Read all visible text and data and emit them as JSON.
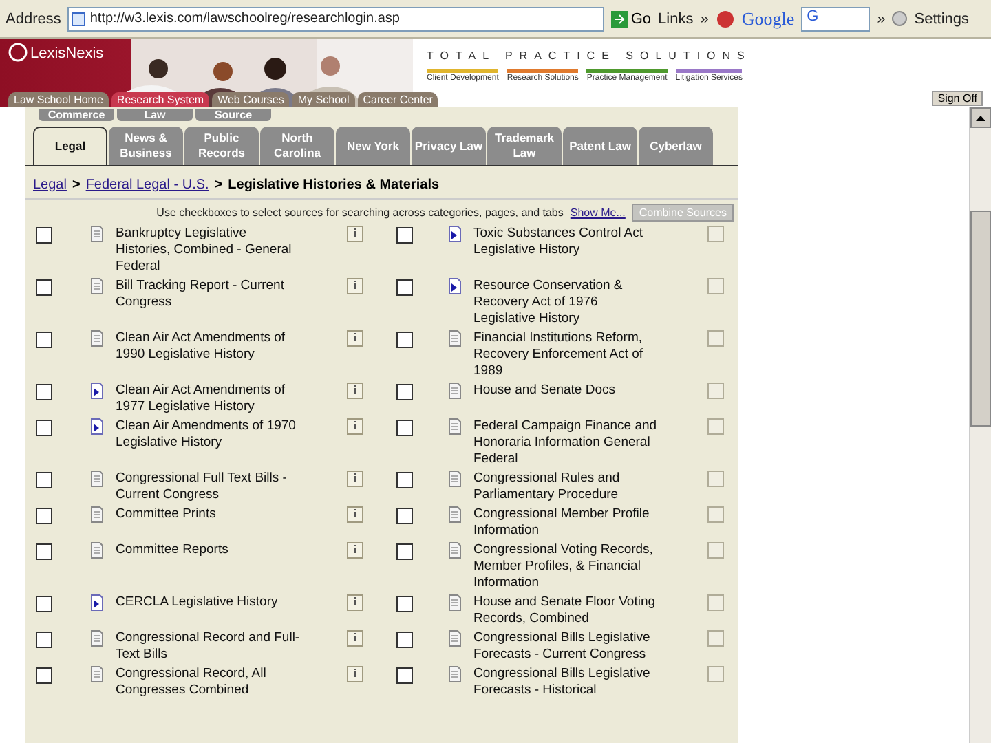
{
  "toolbar": {
    "address_label": "Address",
    "url": "http://w3.lexis.com/lawschoolreg/researchlogin.asp",
    "go": "Go",
    "links": "Links",
    "chevron": "»",
    "search_brand": "Google",
    "search_letter": "G",
    "chevron_2": "»",
    "settings": "Settings"
  },
  "banner": {
    "logo": "LexisNexis",
    "tagline": "TOTAL PRACTICE SOLUTIONS",
    "solutions": [
      {
        "label": "Client Development",
        "color": "#e0b52e"
      },
      {
        "label": "Research Solutions",
        "color": "#e07a2e"
      },
      {
        "label": "Practice Management",
        "color": "#4f9a2e"
      },
      {
        "label": "Litigation Services",
        "color": "#9a78c8"
      }
    ]
  },
  "nav": [
    {
      "label": "Law School Home",
      "selected": false
    },
    {
      "label": "Research System",
      "selected": true
    },
    {
      "label": "Web Courses",
      "selected": false
    },
    {
      "label": "My School",
      "selected": false
    },
    {
      "label": "Career Center",
      "selected": false
    }
  ],
  "sign_off": "Sign Off",
  "back_tabs": [
    "Commerce",
    "Law",
    "Source"
  ],
  "tabs": [
    {
      "label": "Legal",
      "selected": true
    },
    {
      "label": "News & Business",
      "selected": false
    },
    {
      "label": "Public Records",
      "selected": false
    },
    {
      "label": "North Carolina",
      "selected": false
    },
    {
      "label": "New York",
      "selected": false
    },
    {
      "label": "Privacy Law",
      "selected": false
    },
    {
      "label": "Trademark Law",
      "selected": false
    },
    {
      "label": "Patent Law",
      "selected": false
    },
    {
      "label": "Cyberlaw",
      "selected": false
    }
  ],
  "breadcrumb": {
    "links": [
      "Legal",
      "Federal Legal - U.S."
    ],
    "separator": ">",
    "current": "Legislative Histories & Materials"
  },
  "instructions": "Use checkboxes to select sources for searching across categories, pages, and tabs",
  "show_me": "Show Me...",
  "combine": {
    "label": "Combine Sources",
    "disabled": true
  },
  "rows": [
    {
      "left": {
        "title": "Bankruptcy Legislative Histories, Combined - General Federal",
        "kind": "document",
        "checked": false
      },
      "right": {
        "title": "Toxic Substances Control Act Legislative History",
        "kind": "linked",
        "checked": false
      }
    },
    {
      "left": {
        "title": "Bill Tracking Report - Current Congress",
        "kind": "document",
        "checked": false
      },
      "right": {
        "title": "Resource Conservation & Recovery Act of 1976 Legislative History",
        "kind": "linked",
        "checked": false
      }
    },
    {
      "left": {
        "title": "Clean Air Act Amendments of 1990 Legislative History",
        "kind": "document",
        "checked": false
      },
      "right": {
        "title": "Financial Institutions Reform, Recovery Enforcement Act of 1989",
        "kind": "document",
        "checked": false
      }
    },
    {
      "left": {
        "title": "Clean Air Act Amendments of 1977 Legislative History",
        "kind": "linked",
        "checked": false
      },
      "right": {
        "title": "House and Senate Docs",
        "kind": "document",
        "checked": false
      }
    },
    {
      "left": {
        "title": "Clean Air Amendments of 1970 Legislative History",
        "kind": "linked",
        "checked": false
      },
      "right": {
        "title": "Federal Campaign Finance and Honoraria Information General Federal",
        "kind": "document",
        "checked": false
      }
    },
    {
      "left": {
        "title": "Congressional Full Text Bills - Current Congress",
        "kind": "document",
        "checked": false
      },
      "right": {
        "title": "Congressional Rules and Parliamentary Procedure",
        "kind": "document",
        "checked": false
      }
    },
    {
      "left": {
        "title": "Committee Prints",
        "kind": "document",
        "checked": false
      },
      "right": {
        "title": "Congressional Member Profile Information",
        "kind": "document",
        "checked": false
      }
    },
    {
      "left": {
        "title": "Committee Reports",
        "kind": "document",
        "checked": false
      },
      "right": {
        "title": "Congressional Voting Records, Member Profiles, & Financial Information",
        "kind": "document",
        "checked": false
      }
    },
    {
      "left": {
        "title": "CERCLA Legislative History",
        "kind": "linked",
        "checked": false
      },
      "right": {
        "title": "House and Senate Floor Voting Records, Combined",
        "kind": "document",
        "checked": false
      }
    },
    {
      "left": {
        "title": "Congressional Record and Full-Text Bills",
        "kind": "document",
        "checked": false
      },
      "right": {
        "title": "Congressional Bills Legislative Forecasts - Current Congress",
        "kind": "document",
        "checked": false
      }
    },
    {
      "left": {
        "title": "Congressional Record, All Congresses Combined",
        "kind": "document",
        "checked": false
      },
      "right": {
        "title": "Congressional Bills Legislative Forecasts - Historical",
        "kind": "document",
        "checked": false
      }
    }
  ]
}
